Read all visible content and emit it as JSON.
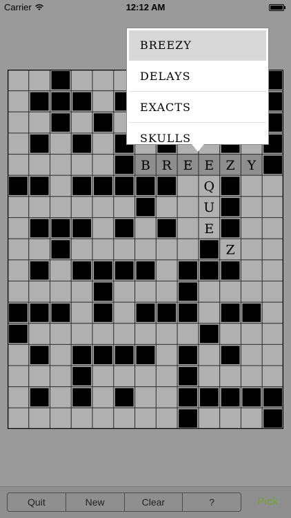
{
  "status_bar": {
    "carrier": "Carrier",
    "time": "12:12 AM"
  },
  "grid": {
    "rows": [
      "..#...#.....#",
      ".###.#.#.#..#",
      "..#.#.##.#..#",
      ".#.#.#.#..#.#",
      ".....#BREEZY#",
      "##.#####.Q#..",
      "......#..U#..",
      ".###.#.#.E#..",
      "..#......#Z..",
      ".#.####.###..",
      "....#...#....",
      "###.#.###.##.",
      "#........#...",
      ".#.####.#.#..",
      "...#....#....",
      ".#.#.#..#####",
      "........#...#"
    ],
    "highlight_row": 4,
    "highlight_cols": [
      6,
      7,
      8,
      9,
      10,
      11
    ],
    "colors": {
      "empty": "#b0b0b0",
      "filled": "#000000",
      "highlight": "#8e8e8e",
      "line": "#333333"
    }
  },
  "popup": {
    "items": [
      "BREEZY",
      "DELAYS",
      "EXACTS",
      "SKULLS"
    ],
    "selected_index": 0
  },
  "toolbar": {
    "buttons": [
      "Quit",
      "New",
      "Clear",
      "?"
    ],
    "pick_label": "Pick",
    "pick_color": "#6ea62a"
  }
}
